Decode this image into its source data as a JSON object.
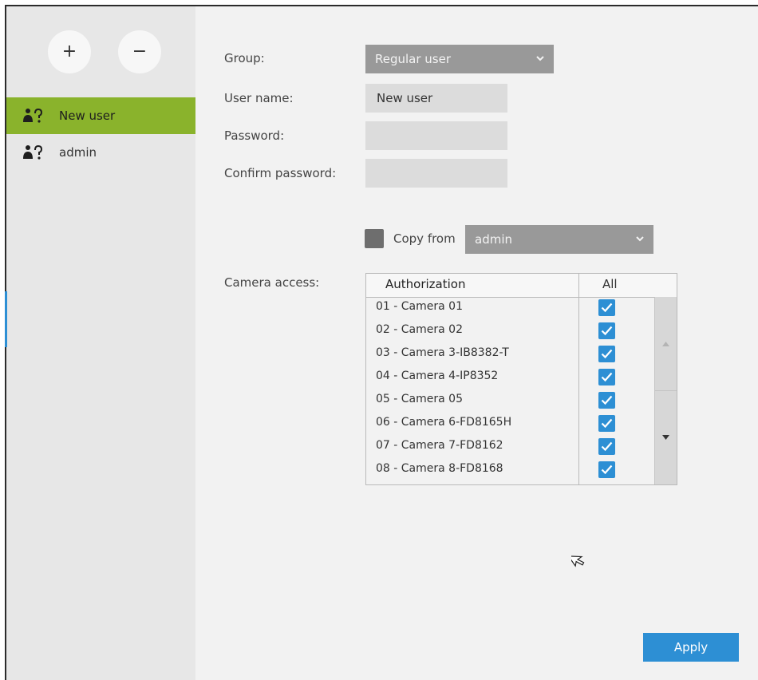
{
  "sidebar": {
    "add_label": "+",
    "remove_label": "−",
    "users": [
      {
        "name": "New user",
        "icon": "user-key-icon",
        "selected": true
      },
      {
        "name": "admin",
        "icon": "user-key-icon",
        "selected": false
      }
    ]
  },
  "form": {
    "group_label": "Group:",
    "group_value": "Regular user",
    "username_label": "User name:",
    "username_value": "New user",
    "password_label": "Password:",
    "password_value": "",
    "confirm_label": "Confirm password:",
    "confirm_value": "",
    "copy_from_label": "Copy from",
    "copy_from_value": "admin",
    "copy_from_checked": false,
    "camera_access_label": "Camera access:"
  },
  "camera_table": {
    "col_authorization": "Authorization",
    "col_all": "All",
    "rows": [
      {
        "name": "01 - Camera 01",
        "checked": true
      },
      {
        "name": "02 - Camera 02",
        "checked": true
      },
      {
        "name": "03 - Camera 3-IB8382-T",
        "checked": true
      },
      {
        "name": "04 - Camera 4-IP8352",
        "checked": true
      },
      {
        "name": "05 - Camera 05",
        "checked": true
      },
      {
        "name": "06 - Camera 6-FD8165H",
        "checked": true
      },
      {
        "name": "07 - Camera 7-FD8162",
        "checked": true
      },
      {
        "name": "08 - Camera 8-FD8168",
        "checked": true
      }
    ]
  },
  "apply_label": "Apply",
  "colors": {
    "accent_blue": "#2d8fd4",
    "selected_green": "#8ab32c",
    "select_gray": "#999999",
    "sidebar_bg": "#e7e7e7",
    "main_bg": "#f2f2f2"
  }
}
